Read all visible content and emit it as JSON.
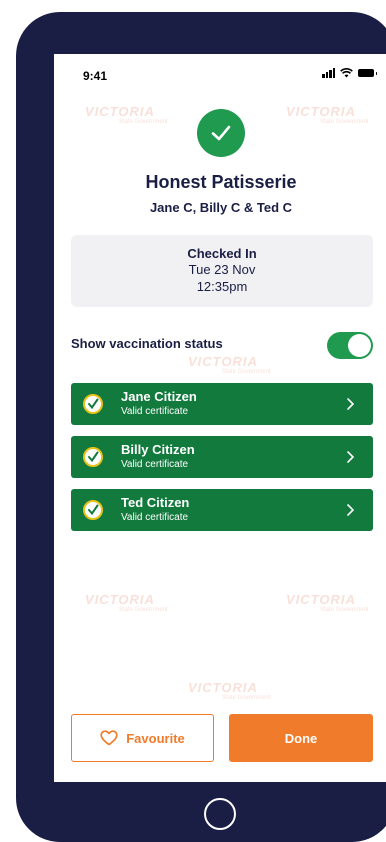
{
  "status_bar": {
    "time": "9:41"
  },
  "watermark": {
    "text": "VICTORIA",
    "subtext": "State Government"
  },
  "venue": {
    "name": "Honest Patisserie",
    "guests": "Jane C, Billy C & Ted C"
  },
  "checkin": {
    "title": "Checked In",
    "date": "Tue 23 Nov",
    "time": "12:35pm"
  },
  "vaccination": {
    "label": "Show vaccination status",
    "enabled": true
  },
  "people": [
    {
      "name": "Jane Citizen",
      "status": "Valid certificate"
    },
    {
      "name": "Billy Citizen",
      "status": "Valid certificate"
    },
    {
      "name": "Ted Citizen",
      "status": "Valid certificate"
    }
  ],
  "actions": {
    "favourite": "Favourite",
    "done": "Done"
  },
  "colors": {
    "green": "#1f9a4e",
    "dark_green": "#127a3d",
    "orange": "#f07b2a",
    "navy": "#1a1e45"
  }
}
